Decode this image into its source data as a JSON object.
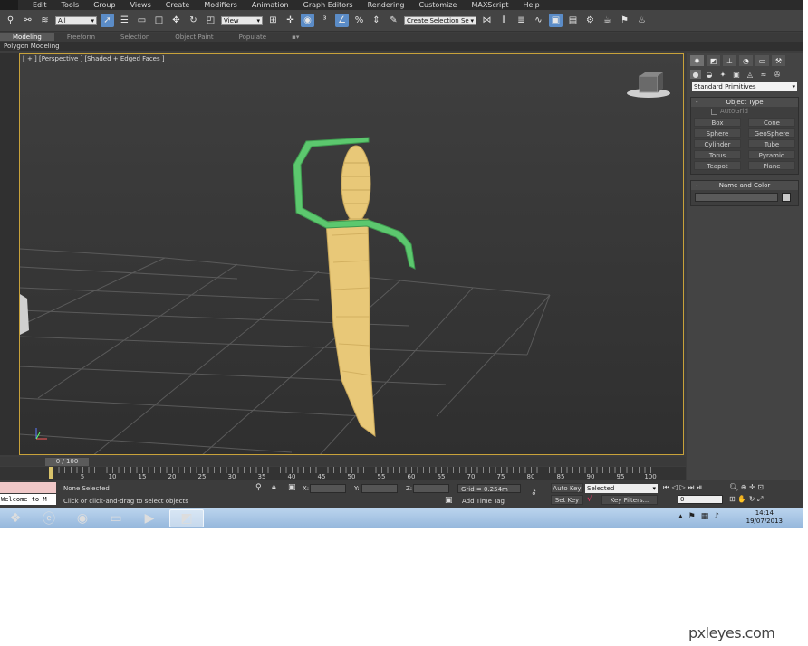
{
  "menubar": {
    "items": [
      "Edit",
      "Tools",
      "Group",
      "Views",
      "Create",
      "Modifiers",
      "Animation",
      "Graph Editors",
      "Rendering",
      "Customize",
      "MAXScript",
      "Help"
    ]
  },
  "toolbar": {
    "filter_value": "All",
    "refcoord_value": "View",
    "selection_set_placeholder": "Create Selection Se",
    "icons": [
      "link-icon",
      "unlink-icon",
      "bind-space-warp-icon",
      "select-object-icon",
      "select-by-name-icon",
      "rect-region-icon",
      "window-crossing-icon",
      "move-icon",
      "rotate-icon",
      "scale-icon",
      "pivot-icon",
      "select-manipulate-icon",
      "snap-icon",
      "angle-snap-icon",
      "percent-snap-icon",
      "spinner-snap-icon",
      "edit-named-sets-icon",
      "mirror-icon",
      "align-icon",
      "layer-icon",
      "curve-editor-icon",
      "schematic-icon",
      "material-editor-icon",
      "render-setup-icon",
      "rendered-frame-icon",
      "render-icon"
    ]
  },
  "ribbon": {
    "tabs": [
      "Modeling",
      "Freeform",
      "Selection",
      "Object Paint",
      "Populate"
    ],
    "active_tab": "Modeling",
    "sub_label": "Polygon Modeling"
  },
  "viewport": {
    "label": "[ + ] [Perspective ] [Shaded + Edged Faces ]"
  },
  "command_panel": {
    "category_value": "Standard Primitives",
    "object_type": {
      "title": "Object Type",
      "autogrid": "AutoGrid",
      "buttons": [
        "Box",
        "Cone",
        "Sphere",
        "GeoSphere",
        "Cylinder",
        "Tube",
        "Torus",
        "Pyramid",
        "Teapot",
        "Plane"
      ]
    },
    "name_color": {
      "title": "Name and Color"
    }
  },
  "timeline": {
    "slider_label": "0 / 100",
    "ticks": [
      "0",
      "5",
      "10",
      "15",
      "20",
      "25",
      "30",
      "35",
      "40",
      "45",
      "50",
      "55",
      "60",
      "65",
      "70",
      "75",
      "80",
      "85",
      "90",
      "95",
      "100"
    ]
  },
  "status": {
    "maxscript_text": "Welcome to M",
    "selection_info": "None Selected",
    "prompt": "Click or click-and-drag to select objects",
    "x_label": "X:",
    "y_label": "Y:",
    "z_label": "Z:",
    "grid": "Grid = 0.254m",
    "add_time_tag": "Add Time Tag",
    "auto_key": "Auto Key",
    "set_key": "Set Key",
    "selected_value": "Selected",
    "key_filters": "Key Filters...",
    "frame_value": "0"
  },
  "taskbar": {
    "time": "14:14",
    "date": "19/07/2013"
  },
  "watermark": "pxleyes.com",
  "colors": {
    "viewport_border": "#c8a23a",
    "blade": "#e8c878",
    "guard": "#5cc86e",
    "active_tool": "#5b8cc7"
  }
}
